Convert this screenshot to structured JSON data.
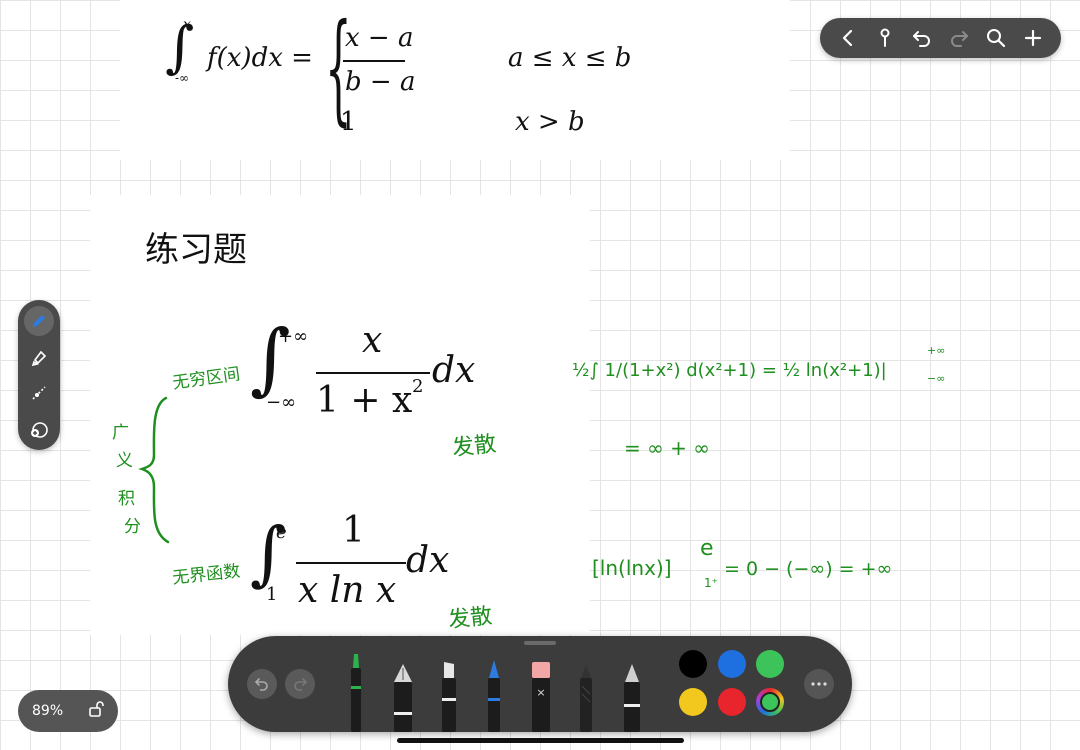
{
  "formula_top": {
    "int_upper": "x",
    "int_lower": "-∞",
    "lhs": "f(x)dx =",
    "frac_num": "x − a",
    "frac_den": "b − a",
    "case1_cond": "a ≤ x ≤ b",
    "case2_val": "1",
    "case2_cond": "x > b"
  },
  "title": "练习题",
  "exercise1": {
    "upper": "+∞",
    "lower": "−∞",
    "numerator": "x",
    "denominator": "1 + x",
    "exp": "2",
    "dx": "dx"
  },
  "exercise2": {
    "upper": "e",
    "lower": "1",
    "numerator": "1",
    "denominator": "x ln x",
    "dx": "dx"
  },
  "handwriting": {
    "label_infinite_interval": "无穷区间",
    "label_unbounded": "无界函数",
    "brace_label_1": "广",
    "brace_label_2": "义",
    "brace_label_3": "积",
    "brace_label_4": "分",
    "diverge_1": "发散",
    "diverge_2": "发散",
    "sol1_line1": "½∫ 1/(1+x²) d(x²+1) = ½ ln(x²+1)|",
    "sol1_upper": "+∞",
    "sol1_lower": "−∞",
    "sol1_line2": "= ∞ + ∞",
    "sol2_line": "[ln(lnx)]",
    "sol2_upper": "e",
    "sol2_lower": "1⁺",
    "sol2_rest": "= 0 − (−∞) = +∞"
  },
  "zoom": {
    "level": "89%"
  },
  "colors": {
    "ink_green": "#1f8f1f",
    "toolbar_bg": "#3c3c3c",
    "swatches": [
      "#000000",
      "#1e6fe0",
      "#3cc45a",
      "#f2c81e",
      "#e8242c",
      "#3cc45a"
    ]
  }
}
